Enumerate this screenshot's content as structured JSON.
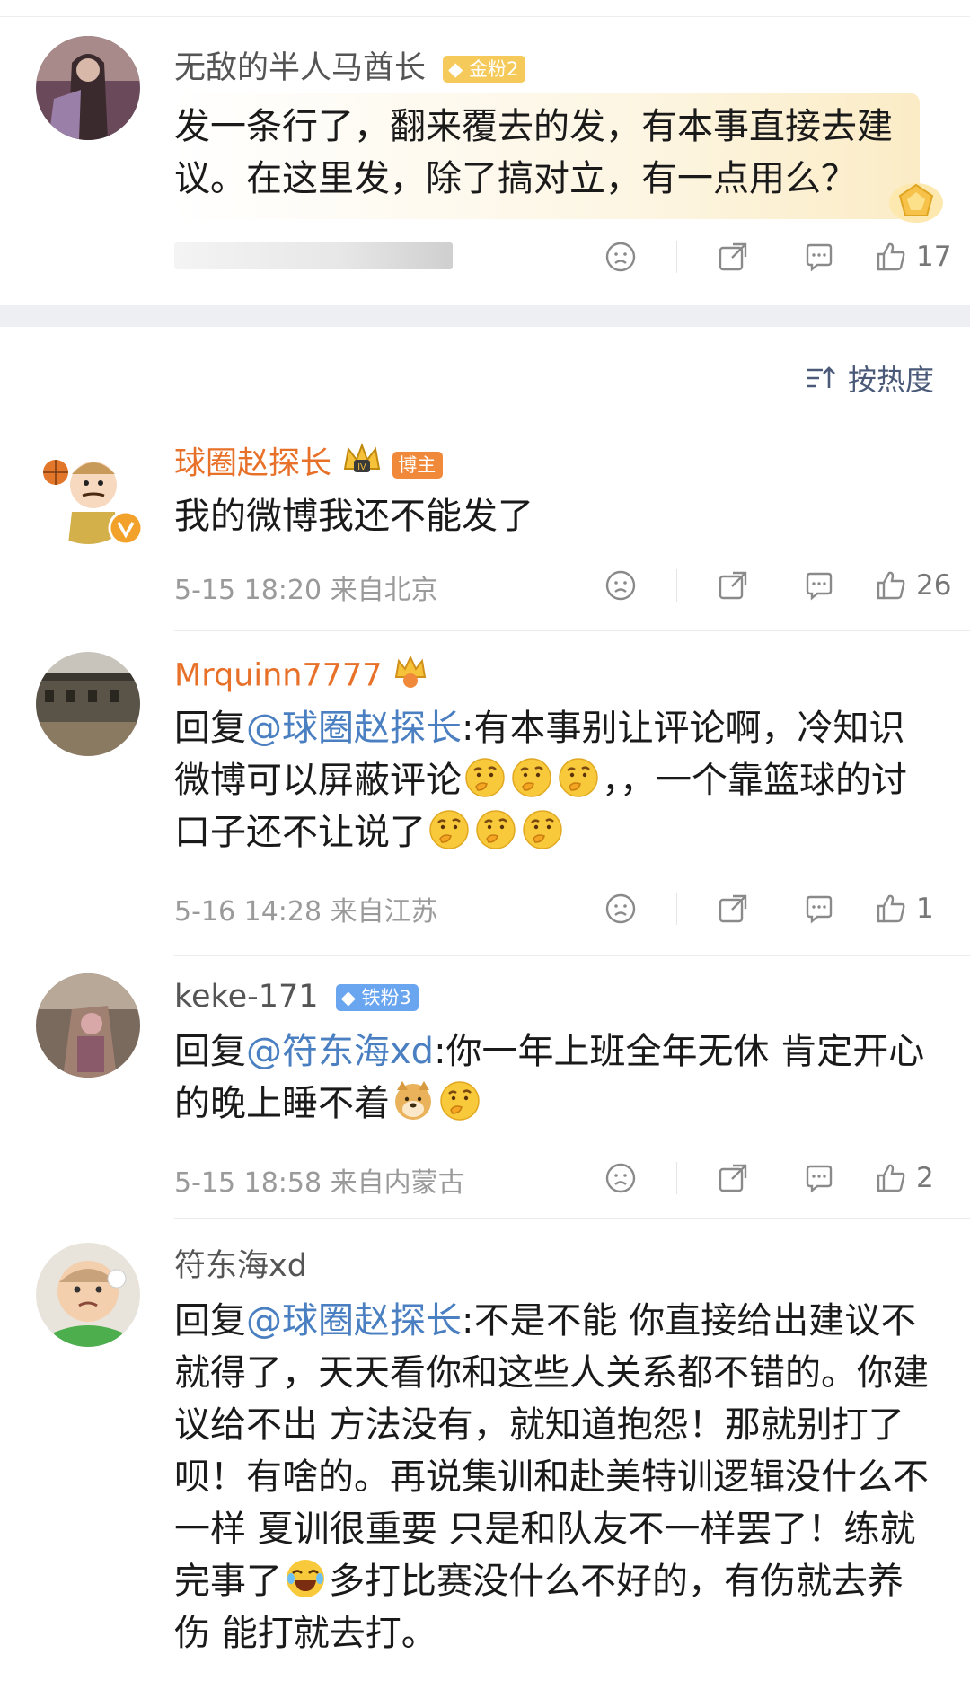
{
  "sort": {
    "label": "按热度"
  },
  "top_comment": {
    "username": "无敌的半人马酋长",
    "badge": "金粉2",
    "text": "发一条行了，翻来覆去的发，有本事直接去建议。在这里发，除了搞对立，有一点用么？",
    "likes": "17"
  },
  "comments": [
    {
      "username": "球圈赵探长",
      "badge": "博主",
      "level_badge": "IV",
      "text": "我的微博我还不能发了",
      "meta": "5-15 18:20 来自北京",
      "likes": "26"
    },
    {
      "username": "Mrquinn7777",
      "reply_prefix": "回复",
      "mention": "@球圈赵探长",
      "text_a": ":有本事别让评论啊，冷知识微博可以屏蔽评论",
      "text_b": "，，一个靠篮球的讨口子还不让说了",
      "meta": "5-16 14:28 来自江苏",
      "likes": "1"
    },
    {
      "username": "keke-171",
      "badge": "铁粉3",
      "reply_prefix": "回复",
      "mention": "@符东海xd",
      "text_a": ":你一年上班全年无休  肯定开心的晚上睡不着",
      "meta": "5-15 18:58 来自内蒙古",
      "likes": "2"
    },
    {
      "username": "符东海xd",
      "reply_prefix": "回复",
      "mention": "@球圈赵探长",
      "text_a": ":不是不能 你直接给出建议不就得了，天天看你和这些人关系都不错的。你建议给不出 方法没有，就知道抱怨！那就别打了呗！有啥的。再说集训和赴美特训逻辑没什么不一样 夏训很重要 只是和队友不一样罢了！练就完事了",
      "text_b": "多打比赛没什么不好的，有伤就去养伤 能打就去打。"
    }
  ],
  "colors": {
    "accent_orange": "#e8712a",
    "mention_blue": "#4a7fc1",
    "separator": "#eeeff2"
  }
}
